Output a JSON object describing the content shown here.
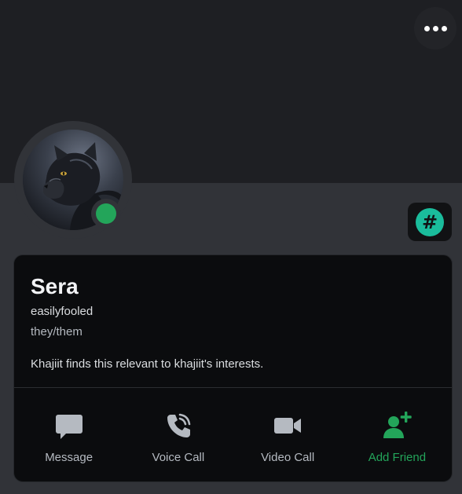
{
  "profile": {
    "display_name": "Sera",
    "username": "easilyfooled",
    "pronouns": "they/them",
    "bio": "Khajiit finds this relevant to khajiit's interests.",
    "status": "online",
    "badge_icon": "hashtag-icon"
  },
  "actions": [
    {
      "label": "Message",
      "icon": "message-icon"
    },
    {
      "label": "Voice Call",
      "icon": "phone-icon"
    },
    {
      "label": "Video Call",
      "icon": "video-icon"
    },
    {
      "label": "Add Friend",
      "icon": "add-friend-icon"
    }
  ],
  "colors": {
    "online": "#23a55a",
    "badge": "#1abc9c",
    "add_friend": "#23a55a"
  }
}
